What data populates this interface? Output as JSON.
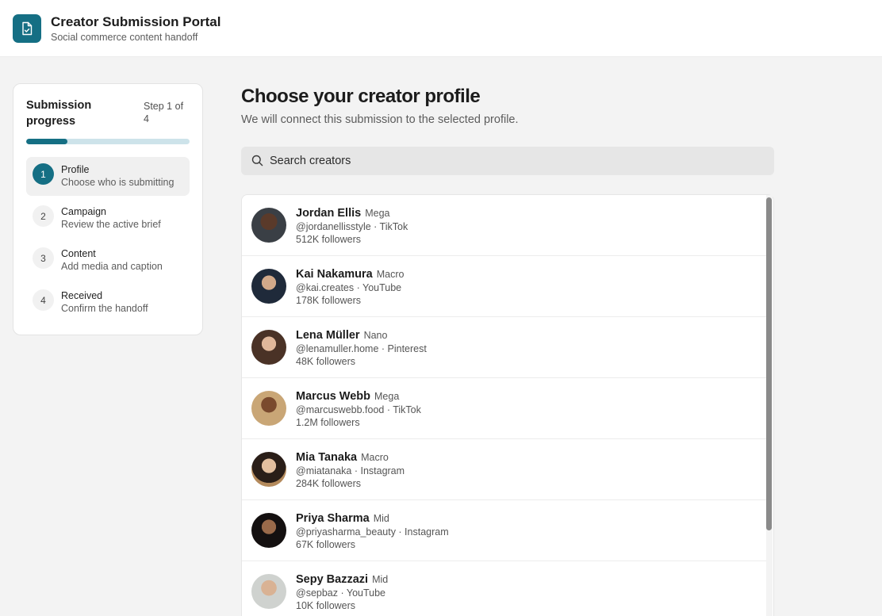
{
  "header": {
    "title": "Creator Submission Portal",
    "subtitle": "Social commerce content handoff",
    "logo_icon": "document-check-icon",
    "brand_color": "#156f84"
  },
  "progress": {
    "title": "Submission progress",
    "step_text": "Step 1 of 4",
    "fraction": 0.25,
    "steps": [
      {
        "number": "1",
        "label": "Profile",
        "description": "Choose who is submitting",
        "active": true
      },
      {
        "number": "2",
        "label": "Campaign",
        "description": "Review the active brief",
        "active": false
      },
      {
        "number": "3",
        "label": "Content",
        "description": "Add media and caption",
        "active": false
      },
      {
        "number": "4",
        "label": "Received",
        "description": "Confirm the handoff",
        "active": false
      }
    ]
  },
  "main": {
    "title": "Choose your creator profile",
    "subtitle": "We will connect this submission to the selected profile.",
    "search": {
      "placeholder": "Search creators",
      "value": "",
      "icon": "search-icon"
    },
    "creators": [
      {
        "name": "Jordan Ellis",
        "tier": "Mega",
        "handle": "@jordanellisstyle · TikTok",
        "followers": "512K followers"
      },
      {
        "name": "Kai Nakamura",
        "tier": "Macro",
        "handle": "@kai.creates · YouTube",
        "followers": "178K followers"
      },
      {
        "name": "Lena Müller",
        "tier": "Nano",
        "handle": "@lenamuller.home · Pinterest",
        "followers": "48K followers"
      },
      {
        "name": "Marcus Webb",
        "tier": "Mega",
        "handle": "@marcuswebb.food · TikTok",
        "followers": "1.2M followers"
      },
      {
        "name": "Mia Tanaka",
        "tier": "Macro",
        "handle": "@miatanaka · Instagram",
        "followers": "284K followers"
      },
      {
        "name": "Priya Sharma",
        "tier": "Mid",
        "handle": "@priyasharma_beauty · Instagram",
        "followers": "67K followers"
      },
      {
        "name": "Sepy Bazzazi",
        "tier": "Mid",
        "handle": "@sepbaz · YouTube",
        "followers": "10K followers"
      }
    ]
  }
}
